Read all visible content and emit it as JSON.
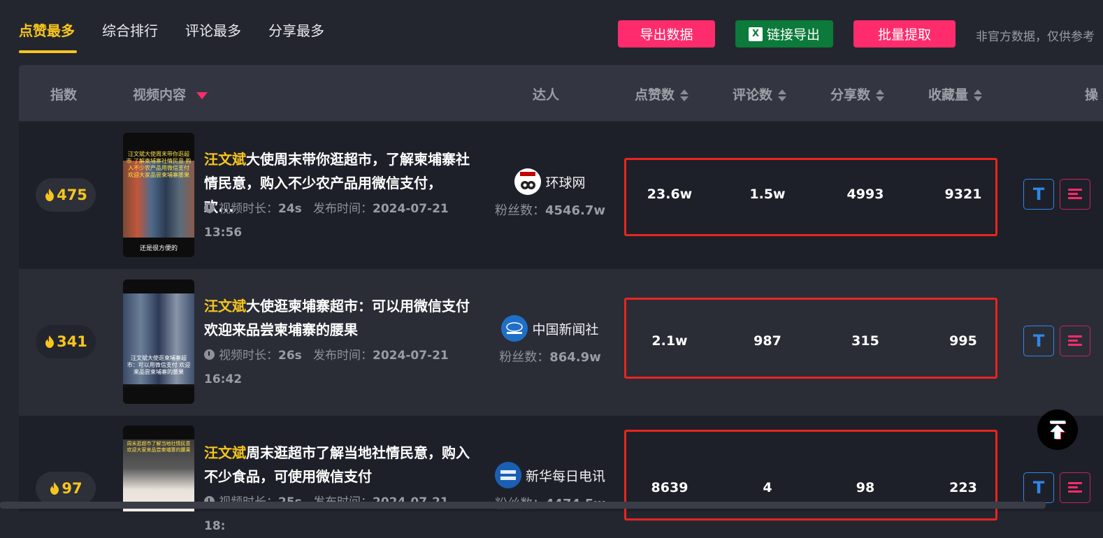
{
  "tabs": [
    {
      "label": "点赞最多",
      "active": true
    },
    {
      "label": "综合排行",
      "active": false
    },
    {
      "label": "评论最多",
      "active": false
    },
    {
      "label": "分享最多",
      "active": false
    }
  ],
  "toolbar": {
    "export_label": "导出数据",
    "link_export_label": "链接导出",
    "batch_label": "批量提取",
    "disclaimer": "非官方数据，仅供参考"
  },
  "columns": {
    "index": "指数",
    "content": "视频内容",
    "author": "达人",
    "likes": "点赞数",
    "comments": "评论数",
    "shares": "分享数",
    "favorites": "收藏量",
    "actions": "操"
  },
  "rows": [
    {
      "index": "475",
      "title_highlight": "汪文斌",
      "title_rest": "大使周末带你逛超市，了解柬埔寨社情民意，购入不少农产品用微信支付，欢...",
      "duration_label": "视频时长：",
      "duration": "24s",
      "published_label": "发布时间：",
      "published": "2024-07-21 13:56",
      "author": "环球网",
      "fans_label": "粉丝数：",
      "fans": "4546.7w",
      "likes": "23.6w",
      "comments": "1.5w",
      "shares": "4993",
      "favorites": "9321",
      "thumb_caption": "汪文斌大使周末带你逛超市 了解柬埔寨社情民意 购入不少农产品用微信支付 欢迎大家品尝柬埔寨腰果",
      "thumb_footer": "还是很方便的"
    },
    {
      "index": "341",
      "title_highlight": "汪文斌",
      "title_rest": "大使逛柬埔寨超市：可以用微信支付 欢迎来品尝柬埔寨的腰果",
      "duration_label": "视频时长：",
      "duration": "26s",
      "published_label": "发布时间：",
      "published": "2024-07-21 16:42",
      "author": "中国新闻社",
      "fans_label": "粉丝数：",
      "fans": "864.9w",
      "likes": "2.1w",
      "comments": "987",
      "shares": "315",
      "favorites": "995",
      "thumb_caption": "汪文斌大使逛柬埔寨超市：可以用微信支付 欢迎来品尝柬埔寨的腰果",
      "thumb_footer": ""
    },
    {
      "index": "97",
      "title_highlight": "汪文斌",
      "title_rest": "周末逛超市了解当地社情民意，购入不少食品，可使用微信支付",
      "duration_label": "视频时长：",
      "duration": "25s",
      "published_label": "发布时间：",
      "published": "2024-07-21 18:",
      "author": "新华每日电讯",
      "fans_label": "粉丝数：",
      "fans": "4474.5w",
      "likes": "8639",
      "comments": "4",
      "shares": "98",
      "favorites": "223",
      "thumb_caption": "周末逛超市了解当地社情民意 欢迎大家来品尝柬埔寨的腰果",
      "thumb_footer": ""
    }
  ],
  "actions": {
    "text_button": "T"
  },
  "colors": {
    "accent_yellow": "#f7c51e",
    "brand_pink": "#fe2c6c",
    "excel_green": "#0b7a3a",
    "highlight_red": "#e8251f"
  }
}
